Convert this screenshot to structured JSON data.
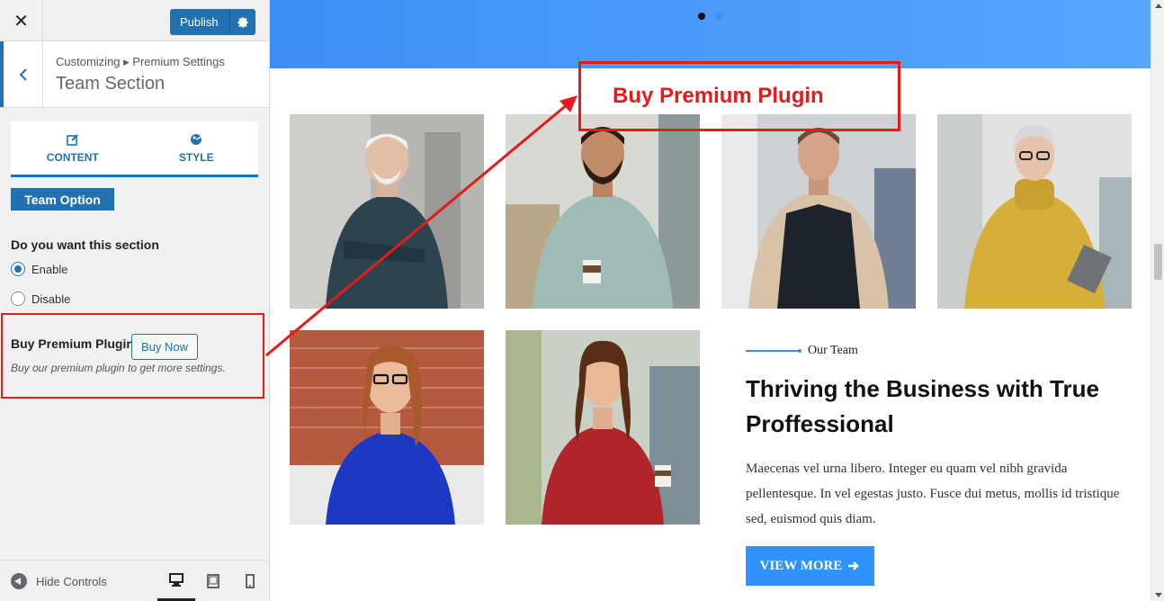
{
  "topbar": {
    "close_glyph": "✕",
    "publish_label": "Publish"
  },
  "section": {
    "breadcrumb": "Customizing ▸ Premium Settings",
    "title": "Team Section"
  },
  "tabs": [
    {
      "label": "CONTENT",
      "icon": "edit-icon"
    },
    {
      "label": "STYLE",
      "icon": "palette-icon"
    }
  ],
  "team_option_label": "Team Option",
  "visibility": {
    "question": "Do you want this section",
    "options": [
      "Enable",
      "Disable"
    ],
    "selected": "Enable"
  },
  "buy": {
    "title": "Buy Premium Plugin",
    "button": "Buy Now",
    "description": "Buy our premium plugin to get more settings."
  },
  "footer": {
    "hide_controls": "Hide Controls",
    "devices": [
      "desktop",
      "tablet",
      "mobile"
    ],
    "active_device": "desktop"
  },
  "preview": {
    "slider_dots": 2,
    "promo_callout": "Buy Premium Plugin",
    "eyebrow": "Our Team",
    "headline": "Thriving the Business with True Proffessional",
    "paragraph": "Maecenas vel urna libero. Integer eu quam vel nibh gravida pellentesque. In vel egestas justo. Fusce dui metus, mollis id tristique sed, euismod quis diam.",
    "cta": "VIEW MORE"
  },
  "colors": {
    "accent": "#2271b1",
    "highlight": "#e21b1b",
    "hero": "#4a9cf8",
    "cta": "#2f93ff"
  }
}
